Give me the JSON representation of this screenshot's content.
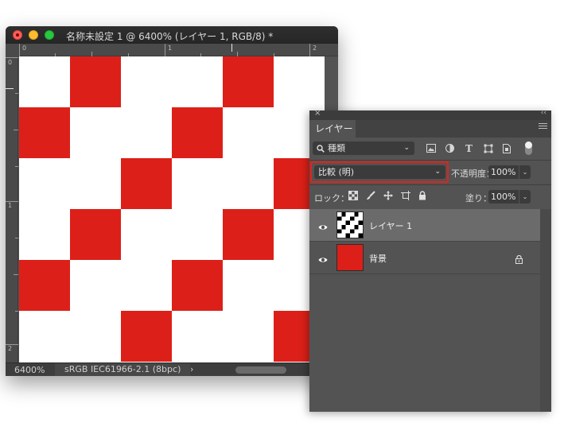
{
  "document": {
    "title": "名称未設定 1 @ 6400% (レイヤー 1, RGB/8) *",
    "ruler_top_labels": [
      "0",
      "1",
      "2"
    ],
    "ruler_left_labels": [
      "0",
      "1",
      "2"
    ],
    "zoom": "6400%",
    "color_profile": "sRGB IEC61966-2.1 (8bpc)",
    "status_menu_glyph": "›",
    "pattern_color": "#dc2019"
  },
  "layers_panel": {
    "tab_label": "レイヤー",
    "close_glyph": "×",
    "collapse_glyph": "‹‹",
    "filter": {
      "kind_label": "種類",
      "search_icon_glyph": "🔍",
      "chevron_glyph": "⌄",
      "icons": [
        "image-filter-icon",
        "adjustment-filter-icon",
        "type-filter-icon",
        "shape-filter-icon",
        "smart-object-filter-icon"
      ],
      "type_glyph": "T"
    },
    "blend_mode": "比較 (明)",
    "blend_chevron": "⌄",
    "opacity_label": "不透明度：",
    "opacity_value": "100%",
    "lock_label": "ロック：",
    "lock_icons": [
      "lock-transparent-pixels-icon",
      "lock-image-pixels-icon",
      "lock-position-icon",
      "lock-artboard-icon",
      "lock-all-icon"
    ],
    "fill_label": "塗り：",
    "fill_value": "100%",
    "arrow_glyph": "⌄",
    "layers": [
      {
        "name": "レイヤー 1",
        "selected": true,
        "visible": true,
        "locked": false
      },
      {
        "name": "背景",
        "selected": false,
        "visible": true,
        "locked": true,
        "fill_color": "#dc2019"
      }
    ]
  }
}
